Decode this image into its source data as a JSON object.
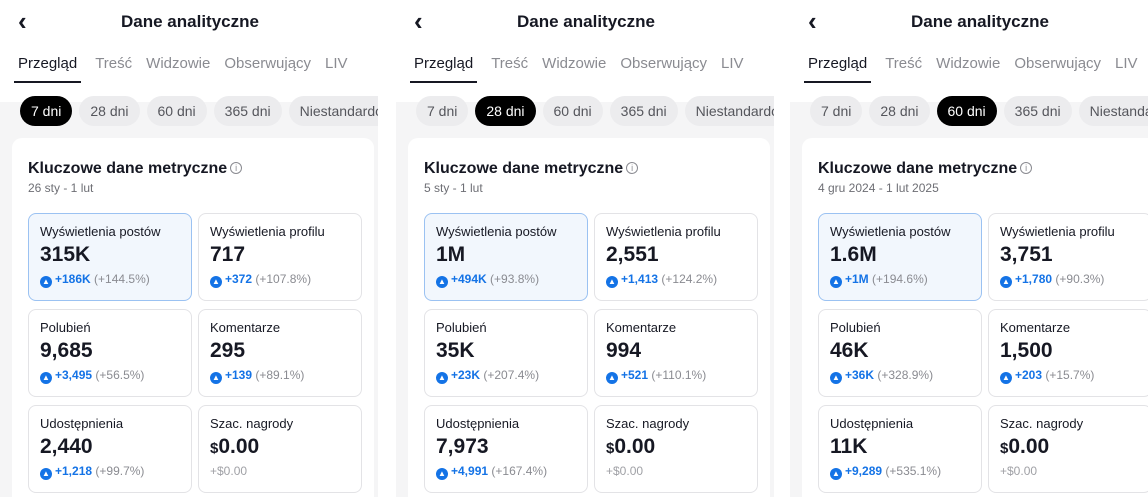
{
  "panels": [
    {
      "header": {
        "back_icon": "chevron-left-icon",
        "title": "Dane analityczne"
      },
      "tabs": [
        "Przegląd",
        "Treść",
        "Widzowie",
        "Obserwujący",
        "LIV"
      ],
      "active_tab": "Przegląd",
      "ranges": [
        "7 dni",
        "28 dni",
        "60 dni",
        "365 dni",
        "Niestandardowy"
      ],
      "active_range": "7 dni",
      "metrics": {
        "title": "Kluczowe dane metryczne",
        "date_range": "26 sty - 1 lut",
        "tiles": [
          {
            "label": "Wyświetlenia postów",
            "value": "315K",
            "delta": "+186K",
            "pct": "(+144.5%)"
          },
          {
            "label": "Wyświetlenia profilu",
            "value": "717",
            "delta": "+372",
            "pct": "(+107.8%)"
          },
          {
            "label": "Polubień",
            "value": "9,685",
            "delta": "+3,495",
            "pct": "(+56.5%)"
          },
          {
            "label": "Komentarze",
            "value": "295",
            "delta": "+139",
            "pct": "(+89.1%)"
          },
          {
            "label": "Udostępnienia",
            "value": "2,440",
            "delta": "+1,218",
            "pct": "(+99.7%)"
          },
          {
            "label": "Szac. nagrody",
            "currency": "$",
            "value": "0.00",
            "change": "+$0.00"
          }
        ]
      }
    },
    {
      "header": {
        "back_icon": "chevron-left-icon",
        "title": "Dane analityczne"
      },
      "tabs": [
        "Przegląd",
        "Treść",
        "Widzowie",
        "Obserwujący",
        "LIV"
      ],
      "active_tab": "Przegląd",
      "ranges": [
        "7 dni",
        "28 dni",
        "60 dni",
        "365 dni",
        "Niestandardowy"
      ],
      "active_range": "28 dni",
      "metrics": {
        "title": "Kluczowe dane metryczne",
        "date_range": "5 sty - 1 lut",
        "tiles": [
          {
            "label": "Wyświetlenia postów",
            "value": "1M",
            "delta": "+494K",
            "pct": "(+93.8%)"
          },
          {
            "label": "Wyświetlenia profilu",
            "value": "2,551",
            "delta": "+1,413",
            "pct": "(+124.2%)"
          },
          {
            "label": "Polubień",
            "value": "35K",
            "delta": "+23K",
            "pct": "(+207.4%)"
          },
          {
            "label": "Komentarze",
            "value": "994",
            "delta": "+521",
            "pct": "(+110.1%)"
          },
          {
            "label": "Udostępnienia",
            "value": "7,973",
            "delta": "+4,991",
            "pct": "(+167.4%)"
          },
          {
            "label": "Szac. nagrody",
            "currency": "$",
            "value": "0.00",
            "change": "+$0.00"
          }
        ]
      }
    },
    {
      "header": {
        "back_icon": "chevron-left-icon",
        "title": "Dane analityczne"
      },
      "tabs": [
        "Przegląd",
        "Treść",
        "Widzowie",
        "Obserwujący",
        "LIV"
      ],
      "active_tab": "Przegląd",
      "ranges": [
        "7 dni",
        "28 dni",
        "60 dni",
        "365 dni",
        "Niestandardowy"
      ],
      "active_range": "60 dni",
      "metrics": {
        "title": "Kluczowe dane metryczne",
        "date_range": "4 gru 2024 - 1 lut 2025",
        "tiles": [
          {
            "label": "Wyświetlenia postów",
            "value": "1.6M",
            "delta": "+1M",
            "pct": "(+194.6%)"
          },
          {
            "label": "Wyświetlenia profilu",
            "value": "3,751",
            "delta": "+1,780",
            "pct": "(+90.3%)"
          },
          {
            "label": "Polubień",
            "value": "46K",
            "delta": "+36K",
            "pct": "(+328.9%)"
          },
          {
            "label": "Komentarze",
            "value": "1,500",
            "delta": "+203",
            "pct": "(+15.7%)"
          },
          {
            "label": "Udostępnienia",
            "value": "11K",
            "delta": "+9,289",
            "pct": "(+535.1%)"
          },
          {
            "label": "Szac. nagrody",
            "currency": "$",
            "value": "0.00",
            "change": "+$0.00"
          }
        ]
      }
    }
  ],
  "colors": {
    "accent": "#1473e6",
    "chip_active": "#000000",
    "highlight_border": "#9bc2f2"
  }
}
